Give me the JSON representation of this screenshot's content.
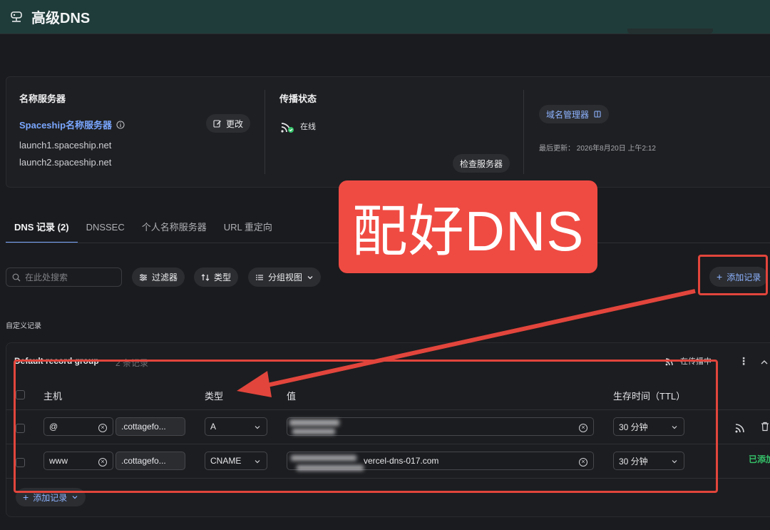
{
  "header": {
    "title": "高级DNS"
  },
  "nameserver": {
    "title": "名称服务器",
    "provider": "Spaceship名称服务器",
    "change_label": "更改",
    "ns1": "launch1.spaceship.net",
    "ns2": "launch2.spaceship.net"
  },
  "propagation": {
    "title": "传播状态",
    "status": "在线",
    "check_label": "检查服务器"
  },
  "domain": {
    "manage_label": "域名管理器",
    "updated_label": "最后更新：",
    "updated_value": "2026年8月20日 上午2:12"
  },
  "tabs": [
    {
      "label": "DNS 记录 (2)"
    },
    {
      "label": "DNSSEC"
    },
    {
      "label": "个人名称服务器"
    },
    {
      "label": "URL 重定向"
    }
  ],
  "toolbar": {
    "search_placeholder": "在此处搜索",
    "filter_label": "过滤器",
    "type_label": "类型",
    "group_view_label": "分组视图",
    "add_record_label": "添加记录"
  },
  "section_label": "自定义记录",
  "group": {
    "name": "Default record group",
    "count": "2 条记录",
    "propagation": "在传播中"
  },
  "table": {
    "headers": {
      "host": "主机",
      "type": "类型",
      "value": "值",
      "ttl": "生存时间（TTL）"
    },
    "rows": [
      {
        "host": "@",
        "domain": ".cottagefo...",
        "type": "A",
        "value": "",
        "ttl": "30 分钟"
      },
      {
        "host": "www",
        "domain": ".cottagefo...",
        "type": "CNAME",
        "value": "vercel-dns-017.com",
        "ttl": "30 分钟",
        "status": "已添加"
      }
    ],
    "add_record_label": "添加记录"
  },
  "annotation": {
    "text": "配好DNS"
  },
  "colors": {
    "accent": "#7aa7ff",
    "annotation": "#ef4b43",
    "success": "#35c26a",
    "header_bg": "#1f3c3a"
  }
}
